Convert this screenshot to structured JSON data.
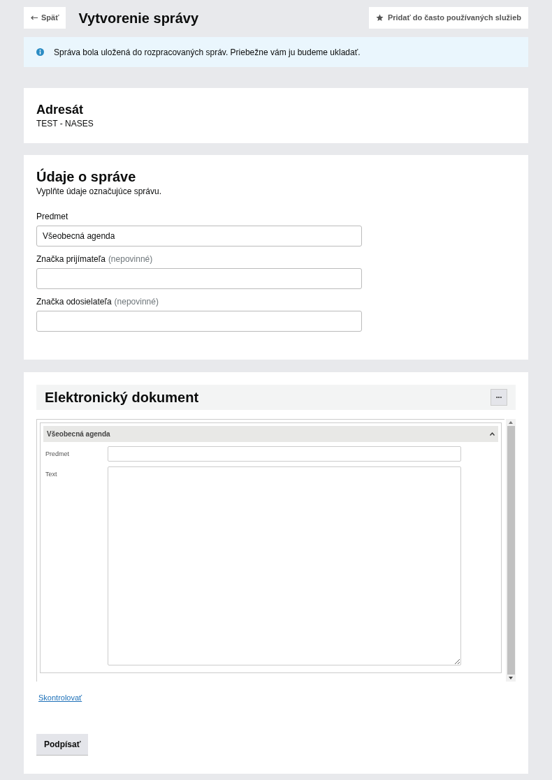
{
  "header": {
    "back_button": "Späť",
    "title": "Vytvorenie správy",
    "favorite_button": "Pridať do často používaných služieb"
  },
  "info_message": "Správa bola uložená do rozpracovaných správ. Priebežne vám ju budeme ukladať.",
  "recipient": {
    "heading": "Adresát",
    "value": "TEST - NASES"
  },
  "message_details": {
    "heading": "Údaje o správe",
    "description": "Vyplňte údaje označujúce správu.",
    "fields": [
      {
        "label": "Predmet",
        "value": "Všeobecná agenda"
      },
      {
        "label": "Značka prijímateľa",
        "hint": "(nepovinné)"
      },
      {
        "label": "Značka odosielateľa",
        "hint": "(nepovinné)"
      }
    ]
  },
  "document": {
    "heading": "Elektronický dokument",
    "menu_button": "•••",
    "form": {
      "section_title": "Všeobecná agenda",
      "expanded": true,
      "fields": [
        {
          "label": "Predmet",
          "kind": "input"
        },
        {
          "label": "Text",
          "kind": "textarea"
        }
      ]
    },
    "check_link": "Skontrolovať"
  },
  "sign_button": "Podpísať"
}
